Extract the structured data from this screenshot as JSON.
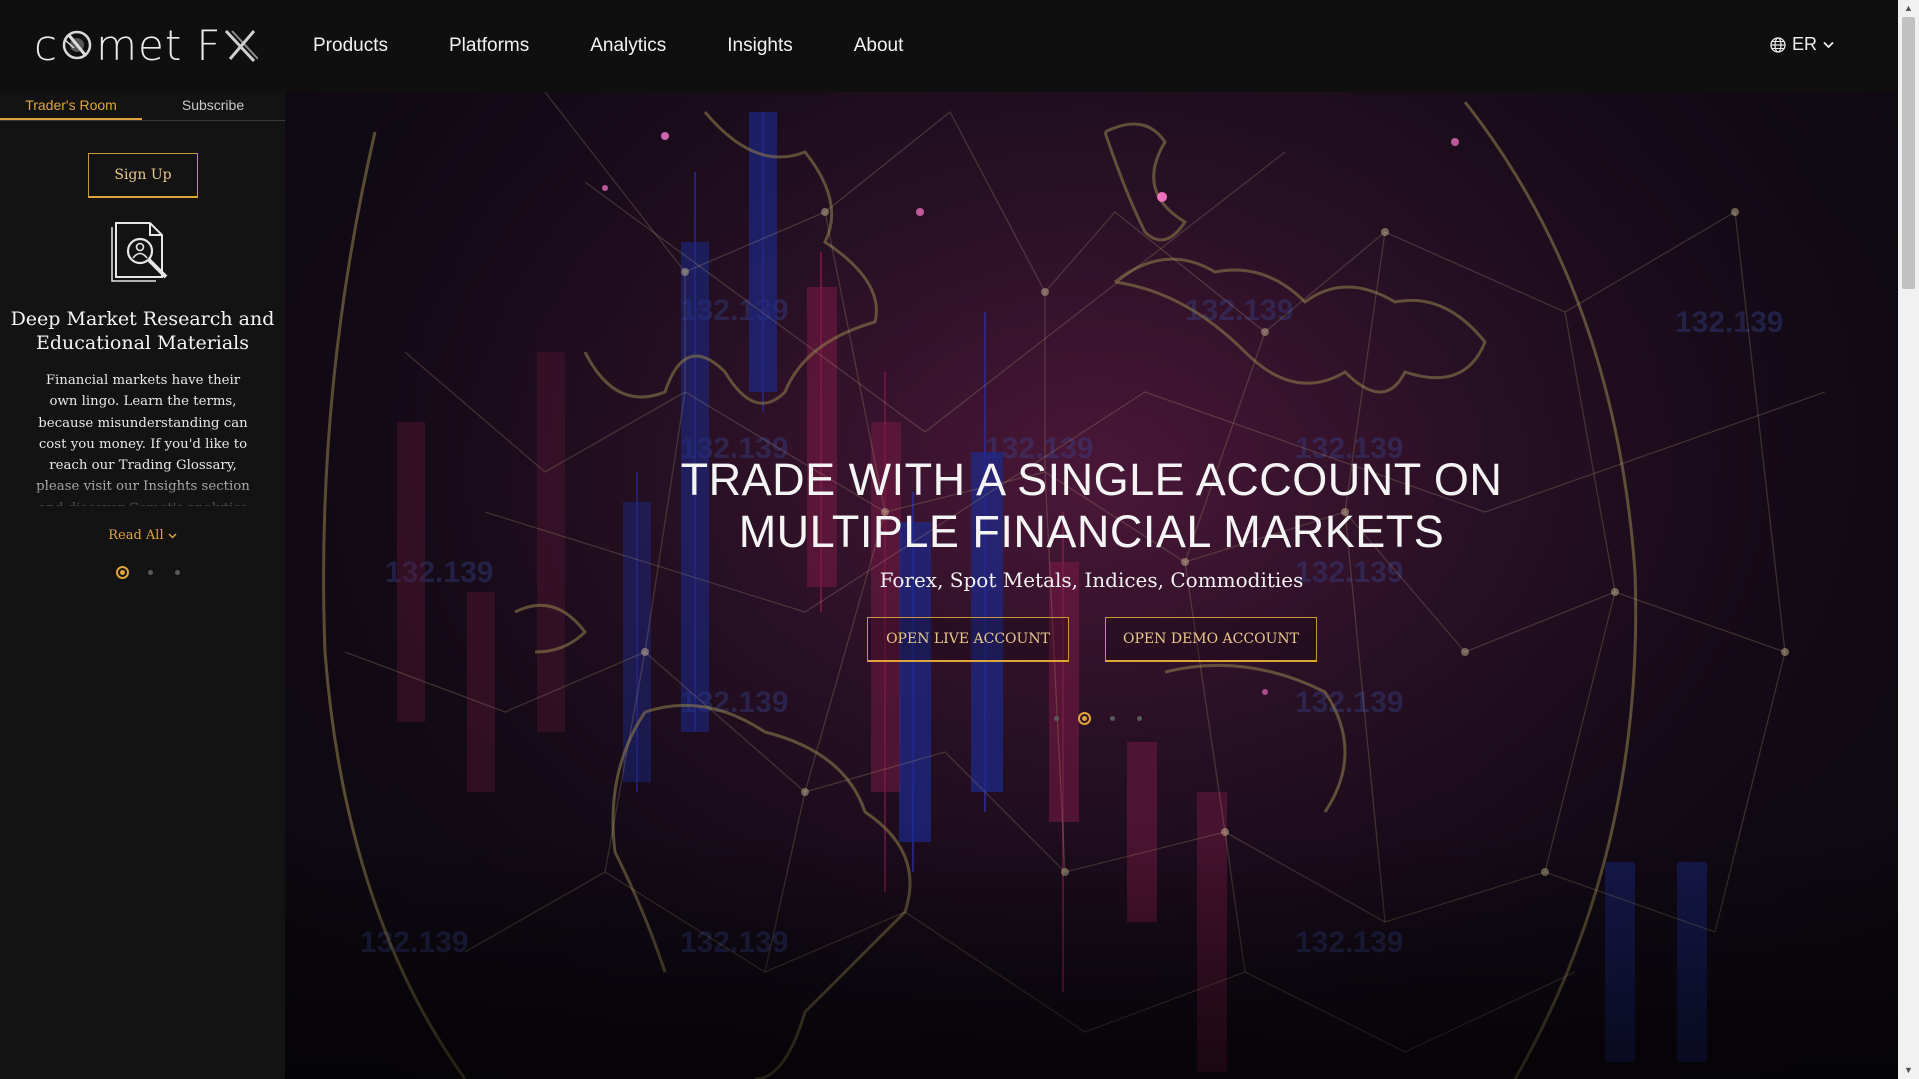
{
  "logo": {
    "text_left": "c",
    "text_mid": "met",
    "text_fx": "F"
  },
  "nav": {
    "items": [
      "Products",
      "Platforms",
      "Analytics",
      "Insights",
      "About"
    ],
    "language": "ER"
  },
  "sidebar": {
    "tabs": [
      {
        "label": "Trader's Room",
        "active": true
      },
      {
        "label": "Subscribe",
        "active": false
      }
    ],
    "signup_label": "Sign Up",
    "title": "Deep Market Research and Educational Materials",
    "text": "Financial markets have their own lingo. Learn the terms, because misunderstanding can cost you money. If you'd like to reach our Trading Glossary, please visit our Insights section and discover Comet's analytics",
    "read_all": "Read All",
    "slides": 3,
    "active_slide": 1
  },
  "hero": {
    "title_line1": "TRADE WITH A SINGLE ACCOUNT ON",
    "title_line2": "MULTIPLE FINANCIAL MARKETS",
    "subtitle": "Forex, Spot Metals, Indices, Commodities",
    "btn_live": "OPEN LIVE ACCOUNT",
    "btn_demo": "OPEN DEMO ACCOUNT",
    "slides": 4,
    "active_slide": 2,
    "bg_price_text": "132.139"
  },
  "colors": {
    "accent": "#e0a43c",
    "topbar": "#0f0f10",
    "sidebar": "#131313"
  }
}
